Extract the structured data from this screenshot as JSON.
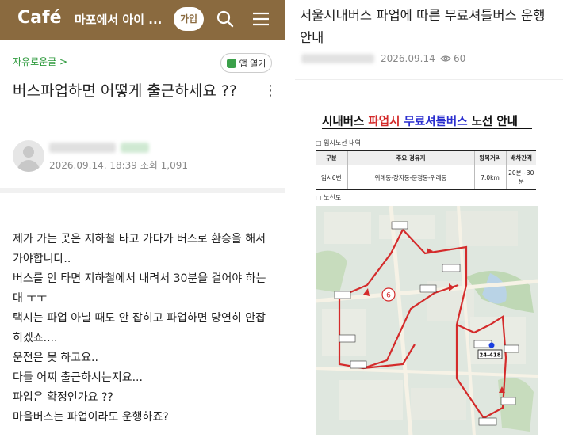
{
  "left": {
    "topbar": {
      "logo": "Café",
      "cafe_name": "마포에서 아이 ...",
      "join_label": "가입"
    },
    "board_link": "자유로운글 >",
    "app_open_label": "앱 열기",
    "post_title": "버스파업하면 어떻게 출근하세요 ??",
    "meta": "2026.09.14. 18:39 조회 1,091",
    "body_lines": [
      "제가 가는 곳은 지하철 타고 가다가 버스로 환승을 해서 가야합니다..",
      "버스를 안 타면 지하철에서 내려서 30분을 걸어야 하는대 ㅜㅜ",
      "택시는 파업 아닐 때도 안 잡히고 파업하면 당연히 안잡히겠죠....",
      "운전은 못 하고요..",
      "다들 어찌 출근하시는지요...",
      "파업은 확정인가요 ??",
      "마을버스는 파업이라도 운행하죠?"
    ]
  },
  "right": {
    "title": "서울시내버스 파업에 따른 무료셔틀버스 운행 안내",
    "date": "2026.09.14",
    "views": "60",
    "notice": {
      "part1": "시내버스 ",
      "part2": "파업시",
      "part3": " ",
      "part4": "무료셔틀버스",
      "part5": " 노선 안내"
    },
    "section1_label": "□ 임시노선 내역",
    "table": {
      "headers": [
        "구분",
        "주요 경유지",
        "왕복거리",
        "배차간격"
      ],
      "rows": [
        [
          "임시6번",
          "위례동-장지동-문정동-위례동",
          "7.0km",
          "20분~30분"
        ]
      ]
    },
    "section2_label": "□ 노선도",
    "map_labels": [
      "24-418",
      "6"
    ]
  },
  "colors": {
    "topbar": "#8a6a3f",
    "board_link": "#2e9a3d",
    "route_line": "#d42b2b",
    "notice_red": "#d42b2b",
    "notice_blue": "#2b2fcf"
  },
  "icons": [
    "search-icon",
    "menu-icon",
    "kebab-icon",
    "eye-icon",
    "app-icon",
    "bus-stop-icon"
  ]
}
